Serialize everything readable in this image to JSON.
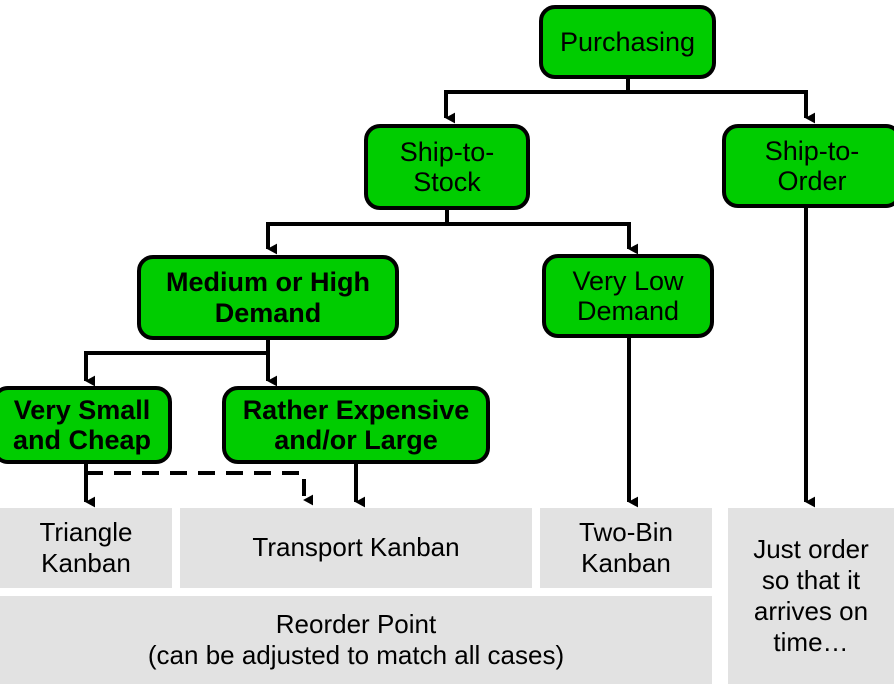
{
  "diagram": {
    "title": "Purchasing decision flowchart for kanban / reorder strategy",
    "colors": {
      "node_fill": "#00cc00",
      "node_border": "#000000",
      "box_fill": "#e2e2e2",
      "line": "#000000",
      "text": "#000000"
    },
    "nodes": [
      {
        "id": "purchasing",
        "label": "Purchasing"
      },
      {
        "id": "ship_to_stock",
        "label": "Ship-to-\nStock"
      },
      {
        "id": "ship_to_order",
        "label": "Ship-to-\nOrder"
      },
      {
        "id": "medium_high_demand",
        "label": "Medium or High\nDemand"
      },
      {
        "id": "very_low_demand",
        "label": "Very Low\nDemand"
      },
      {
        "id": "very_small_cheap",
        "label": "Very Small\nand Cheap"
      },
      {
        "id": "rather_expensive_large",
        "label": "Rather Expensive\nand/or Large"
      }
    ],
    "outcomes": [
      {
        "id": "triangle_kanban",
        "label": "Triangle\nKanban"
      },
      {
        "id": "transport_kanban",
        "label": "Transport Kanban"
      },
      {
        "id": "two_bin_kanban",
        "label": "Two-Bin\nKanban"
      },
      {
        "id": "just_order",
        "label": "Just order\nso that it\narrives on\ntime…"
      },
      {
        "id": "reorder_point",
        "label": "Reorder Point\n(can be adjusted to match all cases)"
      }
    ],
    "edges": [
      {
        "from": "purchasing",
        "to": "ship_to_stock",
        "style": "solid"
      },
      {
        "from": "purchasing",
        "to": "ship_to_order",
        "style": "solid"
      },
      {
        "from": "ship_to_stock",
        "to": "medium_high_demand",
        "style": "solid"
      },
      {
        "from": "ship_to_stock",
        "to": "very_low_demand",
        "style": "solid"
      },
      {
        "from": "medium_high_demand",
        "to": "very_small_cheap",
        "style": "solid"
      },
      {
        "from": "medium_high_demand",
        "to": "rather_expensive_large",
        "style": "solid"
      },
      {
        "from": "very_small_cheap",
        "to": "triangle_kanban",
        "style": "solid"
      },
      {
        "from": "very_small_cheap",
        "to": "transport_kanban",
        "style": "dashed"
      },
      {
        "from": "rather_expensive_large",
        "to": "transport_kanban",
        "style": "solid"
      },
      {
        "from": "very_low_demand",
        "to": "two_bin_kanban",
        "style": "solid"
      },
      {
        "from": "ship_to_order",
        "to": "just_order",
        "style": "solid"
      }
    ]
  }
}
